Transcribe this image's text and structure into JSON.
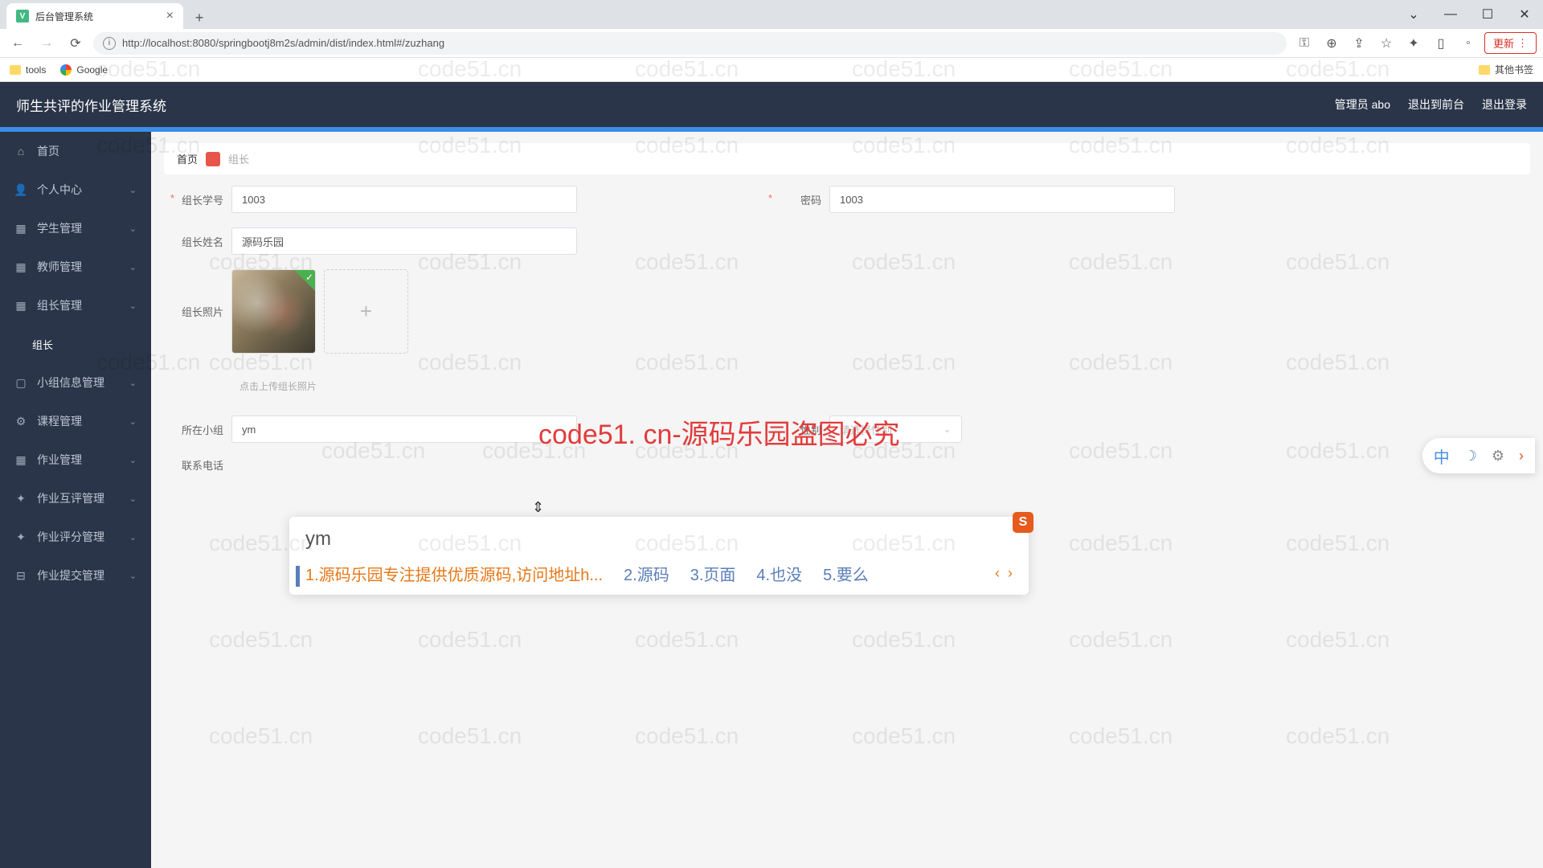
{
  "browser": {
    "tab_title": "后台管理系统",
    "url": "http://localhost:8080/springbootj8m2s/admin/dist/index.html#/zuzhang",
    "update_label": "更新",
    "bookmarks": {
      "tools": "tools",
      "google": "Google",
      "other": "其他书签"
    }
  },
  "topbar": {
    "title": "师生共评的作业管理系统",
    "user": "管理员 abo",
    "to_front": "退出到前台",
    "logout": "退出登录"
  },
  "sidebar": {
    "items": [
      {
        "label": "首页"
      },
      {
        "label": "个人中心"
      },
      {
        "label": "学生管理"
      },
      {
        "label": "教师管理"
      },
      {
        "label": "组长管理"
      },
      {
        "label": "组长"
      },
      {
        "label": "小组信息管理"
      },
      {
        "label": "课程管理"
      },
      {
        "label": "作业管理"
      },
      {
        "label": "作业互评管理"
      },
      {
        "label": "作业评分管理"
      },
      {
        "label": "作业提交管理"
      }
    ]
  },
  "breadcrumb": {
    "home": "首页",
    "current": "组长"
  },
  "form": {
    "student_id_label": "组长学号",
    "student_id_value": "1003",
    "password_label": "密码",
    "password_value": "1003",
    "name_label": "组长姓名",
    "name_value": "源码乐园",
    "photo_label": "组长照片",
    "photo_hint": "点击上传组长照片",
    "group_label": "所在小组",
    "group_value": "ym",
    "gender_label": "性别",
    "gender_placeholder": "请选择性别",
    "phone_label": "联系电话"
  },
  "ime": {
    "typed": "ym",
    "candidates": [
      "1.源码乐园专注提供优质源码,访问地址h...",
      "2.源码",
      "3.页面",
      "4.也没",
      "5.要么"
    ],
    "badge": "S"
  },
  "ime_toolbar": {
    "cn": "中"
  },
  "watermark": {
    "text": "code51.cn",
    "big": "code51. cn-源码乐园盗图必究"
  }
}
